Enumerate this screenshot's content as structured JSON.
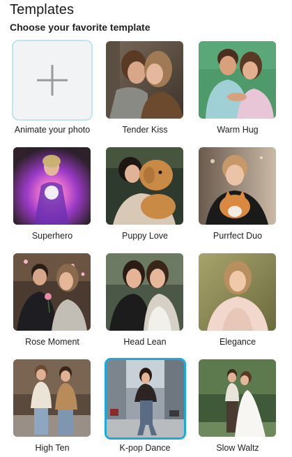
{
  "header": {
    "title": "Templates",
    "subtitle": "Choose your favorite template"
  },
  "templates": [
    {
      "label": "Animate your photo",
      "icon": "plus-icon",
      "selected": false
    },
    {
      "label": "Tender Kiss",
      "icon": "photo-thumbnail",
      "selected": false
    },
    {
      "label": "Warm Hug",
      "icon": "photo-thumbnail",
      "selected": false
    },
    {
      "label": "Superhero",
      "icon": "photo-thumbnail",
      "selected": false
    },
    {
      "label": "Puppy Love",
      "icon": "photo-thumbnail",
      "selected": false
    },
    {
      "label": "Purrfect Duo",
      "icon": "photo-thumbnail",
      "selected": false
    },
    {
      "label": "Rose Moment",
      "icon": "photo-thumbnail",
      "selected": false
    },
    {
      "label": "Head Lean",
      "icon": "photo-thumbnail",
      "selected": false
    },
    {
      "label": "Elegance",
      "icon": "photo-thumbnail",
      "selected": false
    },
    {
      "label": "High Ten",
      "icon": "photo-thumbnail",
      "selected": false
    },
    {
      "label": "K-pop Dance",
      "icon": "photo-thumbnail",
      "selected": true
    },
    {
      "label": "Slow Waltz",
      "icon": "photo-thumbnail",
      "selected": false
    }
  ],
  "colors": {
    "selected_border": "#1aa9d8",
    "add_border": "#bfe4f3",
    "add_background": "#f2f3f4",
    "plus_color": "#9a9a9a"
  }
}
